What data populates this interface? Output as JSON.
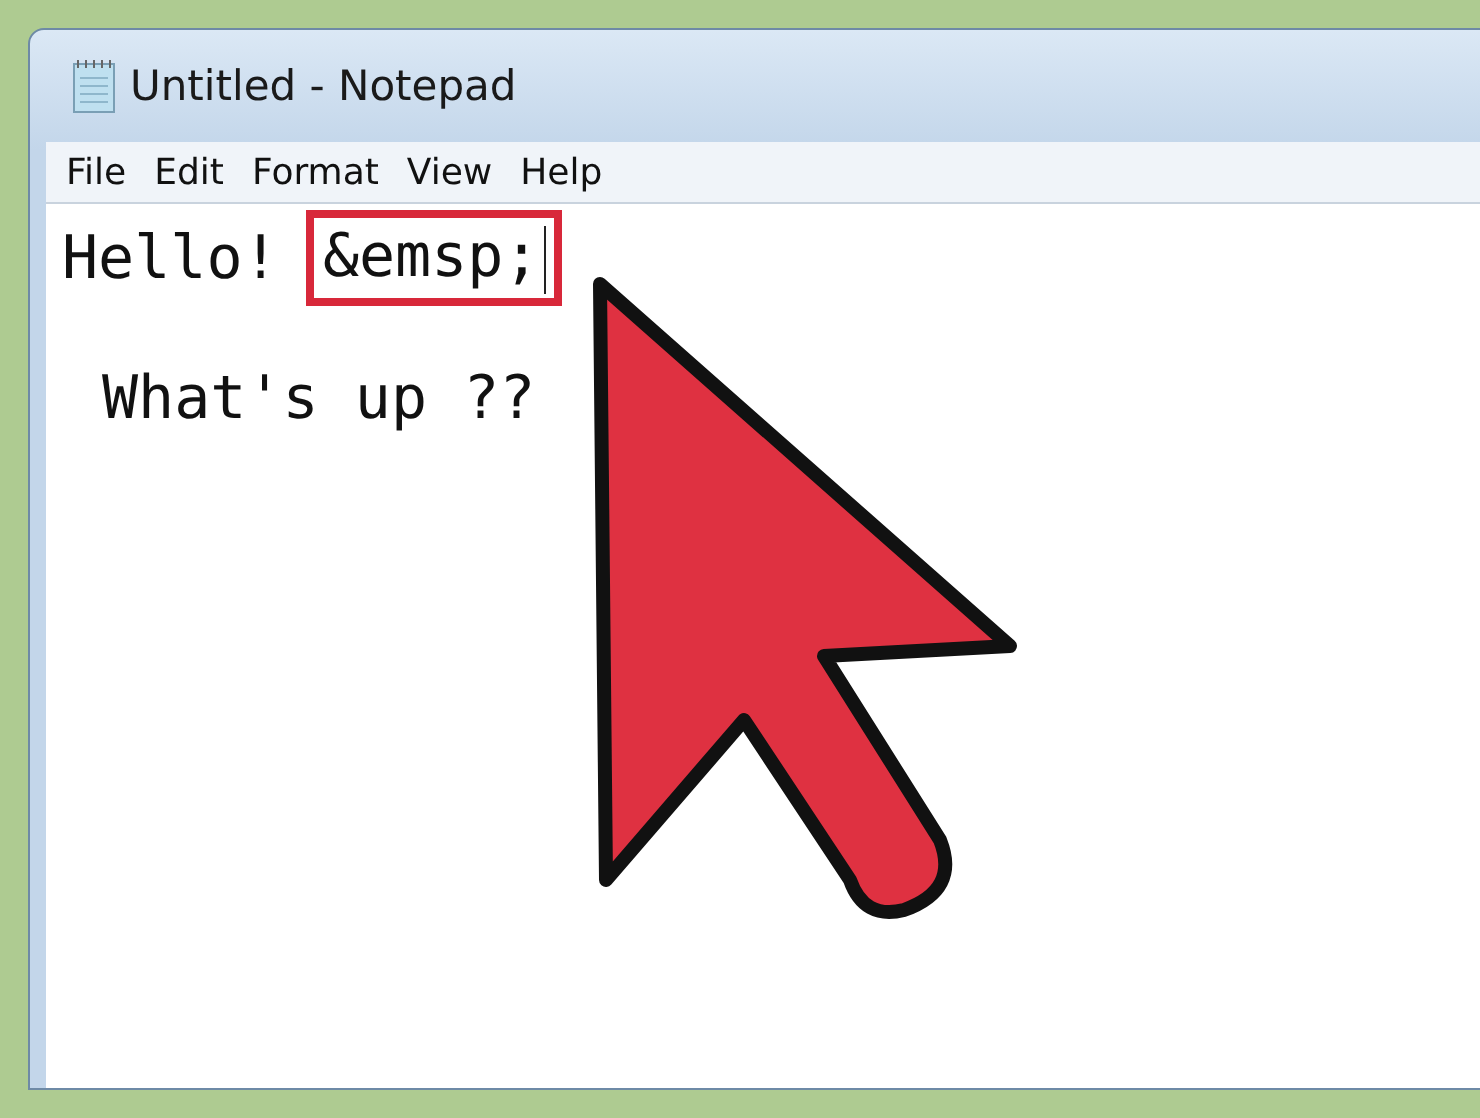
{
  "window": {
    "title": "Untitled - Notepad"
  },
  "menu": [
    "File",
    "Edit",
    "Format",
    "View",
    "Help"
  ],
  "document": {
    "lines": [
      {
        "segments": [
          {
            "text": "Hello! ",
            "highlighted": false,
            "caret": false
          },
          {
            "text": "&emsp;",
            "highlighted": true,
            "caret": true
          }
        ]
      },
      {
        "segments": [
          {
            "text": "What's up ??",
            "highlighted": false,
            "caret": false
          }
        ]
      }
    ]
  },
  "pointer": {
    "visible": true
  }
}
